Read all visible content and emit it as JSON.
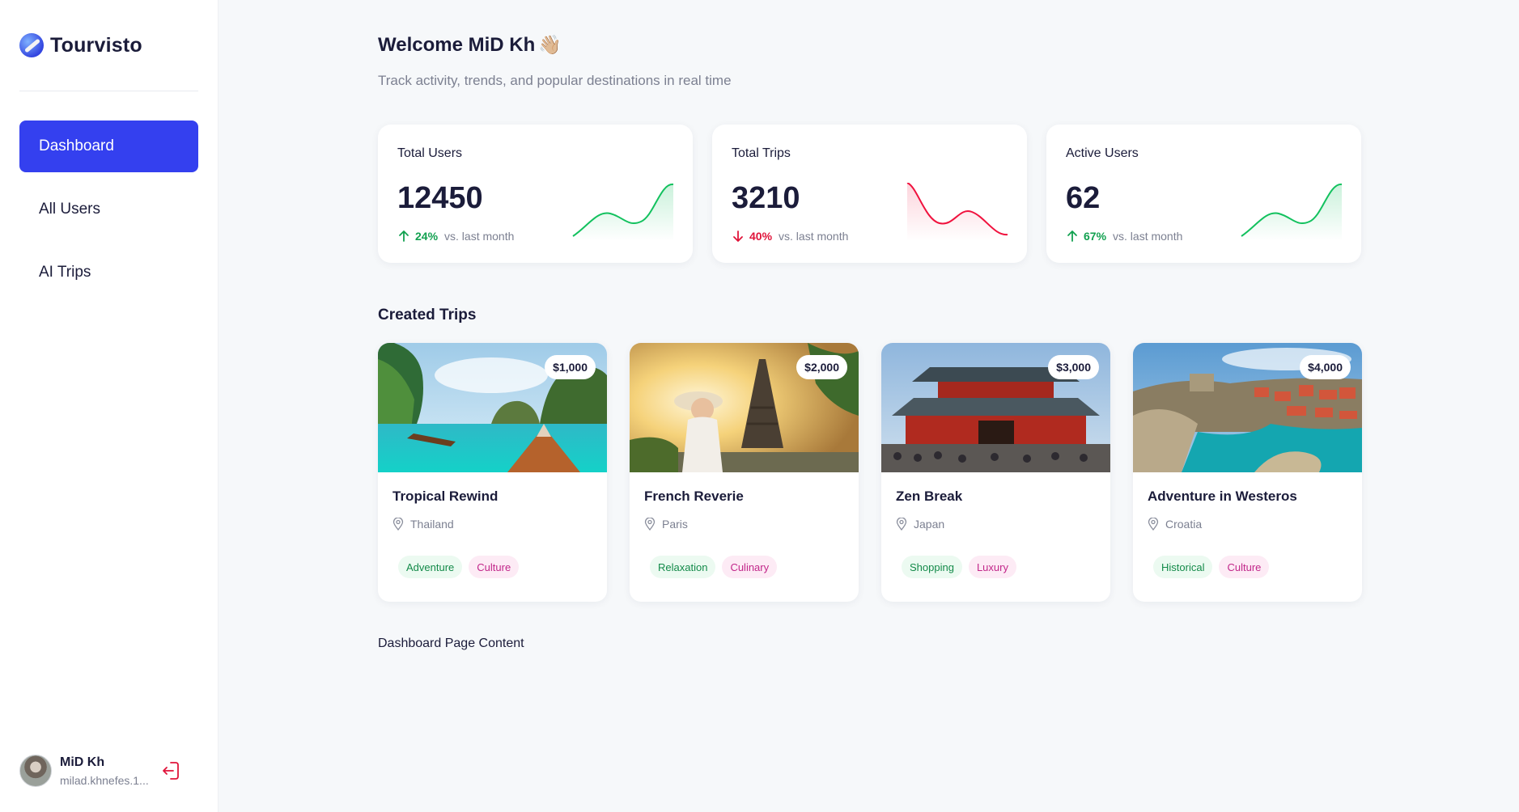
{
  "sidebar": {
    "brand": "Tourvisto",
    "brand_icon": "globe-plane-icon",
    "nav": [
      {
        "label": "Dashboard",
        "active": true
      },
      {
        "label": "All Users",
        "active": false
      },
      {
        "label": "AI Trips",
        "active": false
      }
    ],
    "user": {
      "name": "MiD Kh",
      "email": "milad.khnefes.1...",
      "logout_icon": "logout-icon"
    }
  },
  "header": {
    "welcome": "Welcome MiD Kh",
    "wave_emoji": "👋🏼",
    "subtitle": "Track activity, trends, and popular destinations in real time"
  },
  "stats": [
    {
      "title": "Total Users",
      "value": "12450",
      "change": "24%",
      "direction": "up",
      "vs": "vs. last month",
      "color": "#12c15e"
    },
    {
      "title": "Total Trips",
      "value": "3210",
      "change": "40%",
      "direction": "down",
      "vs": "vs. last month",
      "color": "#f0123e"
    },
    {
      "title": "Active Users",
      "value": "62",
      "change": "67%",
      "direction": "up",
      "vs": "vs. last month",
      "color": "#12c15e"
    }
  ],
  "trips_section": {
    "title": "Created Trips",
    "trips": [
      {
        "name": "Tropical Rewind",
        "location": "Thailand",
        "price": "$1,000",
        "tags": [
          "Adventure",
          "Culture"
        ]
      },
      {
        "name": "French Reverie",
        "location": "Paris",
        "price": "$2,000",
        "tags": [
          "Relaxation",
          "Culinary"
        ]
      },
      {
        "name": "Zen Break",
        "location": "Japan",
        "price": "$3,000",
        "tags": [
          "Shopping",
          "Luxury"
        ]
      },
      {
        "name": "Adventure in Westeros",
        "location": "Croatia",
        "price": "$4,000",
        "tags": [
          "Historical",
          "Culture"
        ]
      }
    ]
  },
  "page_content": "Dashboard Page Content",
  "colors": {
    "accent": "#3440ef",
    "up": "#12a150",
    "down": "#e0143a",
    "tag_green_bg": "#ecfaf1",
    "tag_pink_bg": "#fdebf5"
  }
}
